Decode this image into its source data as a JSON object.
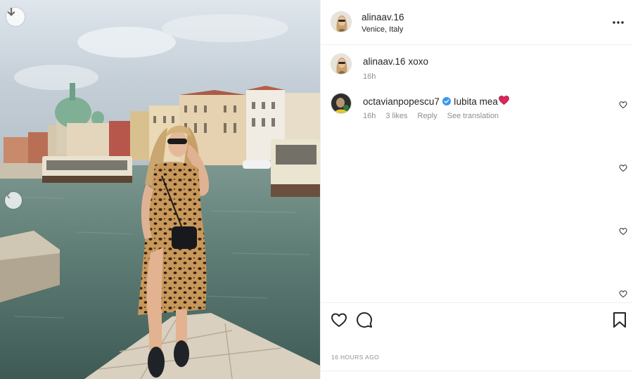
{
  "post": {
    "username": "alinaav.16",
    "location": "Venice, Italy",
    "time_ago": "16 HOURS AGO"
  },
  "comments": [
    {
      "username": "alinaav.16",
      "text": "xoxo",
      "time": "16h",
      "verified": false
    },
    {
      "username": "octavianpopescu7",
      "text": "Iubita mea",
      "emoji": "❤️",
      "time": "16h",
      "likes": "3 likes",
      "reply": "Reply",
      "translate": "See translation",
      "verified": true
    }
  ],
  "icons": {
    "download": "download-icon",
    "prev": "chevron-left-icon",
    "more": "more-options-icon",
    "like": "heart-icon",
    "comment": "comment-icon",
    "save": "bookmark-icon",
    "verified": "verified-badge-icon"
  },
  "colors": {
    "verified": "#3897f0",
    "heart_emoji": "#e0245e",
    "meta_text": "#8e8e8e"
  }
}
